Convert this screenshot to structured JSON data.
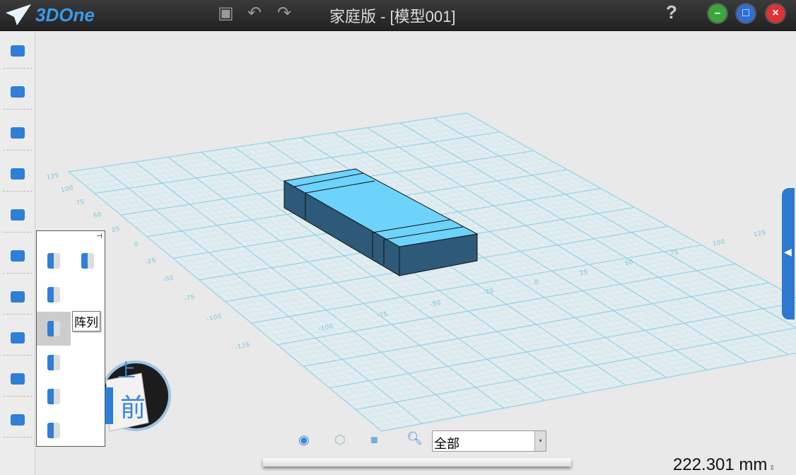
{
  "app": {
    "logo": "3DOne",
    "title": "家庭版 - [模型001]",
    "help": "?"
  },
  "toolbar": {
    "icons": [
      "save-icon",
      "undo-icon",
      "redo-icon"
    ]
  },
  "window": {
    "minimize": "–",
    "maximize": "□",
    "close": "×"
  },
  "sidebar": {
    "items": [
      "basic-solid",
      "sketch",
      "sketch-edit",
      "special-features",
      "combine",
      "move",
      "adsorption",
      "group",
      "distance-measure",
      "material"
    ]
  },
  "panel": {
    "tooltip": "阵列",
    "items": [
      "extrude",
      "twist",
      "pull-face",
      "array",
      "mirror",
      "shell",
      "split"
    ]
  },
  "navcube": {
    "top": "上",
    "front": "前"
  },
  "grid": {
    "row_labels": [
      "125",
      "100",
      "75",
      "50",
      "25",
      "0",
      "-25",
      "-50",
      "-75",
      "-100",
      "-125"
    ],
    "col_labels": [
      "-100",
      "-75",
      "-50",
      "-25",
      "0",
      "25",
      "50",
      "75",
      "100",
      "125"
    ]
  },
  "bottom": {
    "filter_value": "全部"
  },
  "status": {
    "measurement": "222.301 mm"
  },
  "colors": {
    "accent": "#2f78d0",
    "box_top": "#6dd3fb",
    "box_side": "#2c5a78",
    "grid": "#8fd3e8"
  }
}
